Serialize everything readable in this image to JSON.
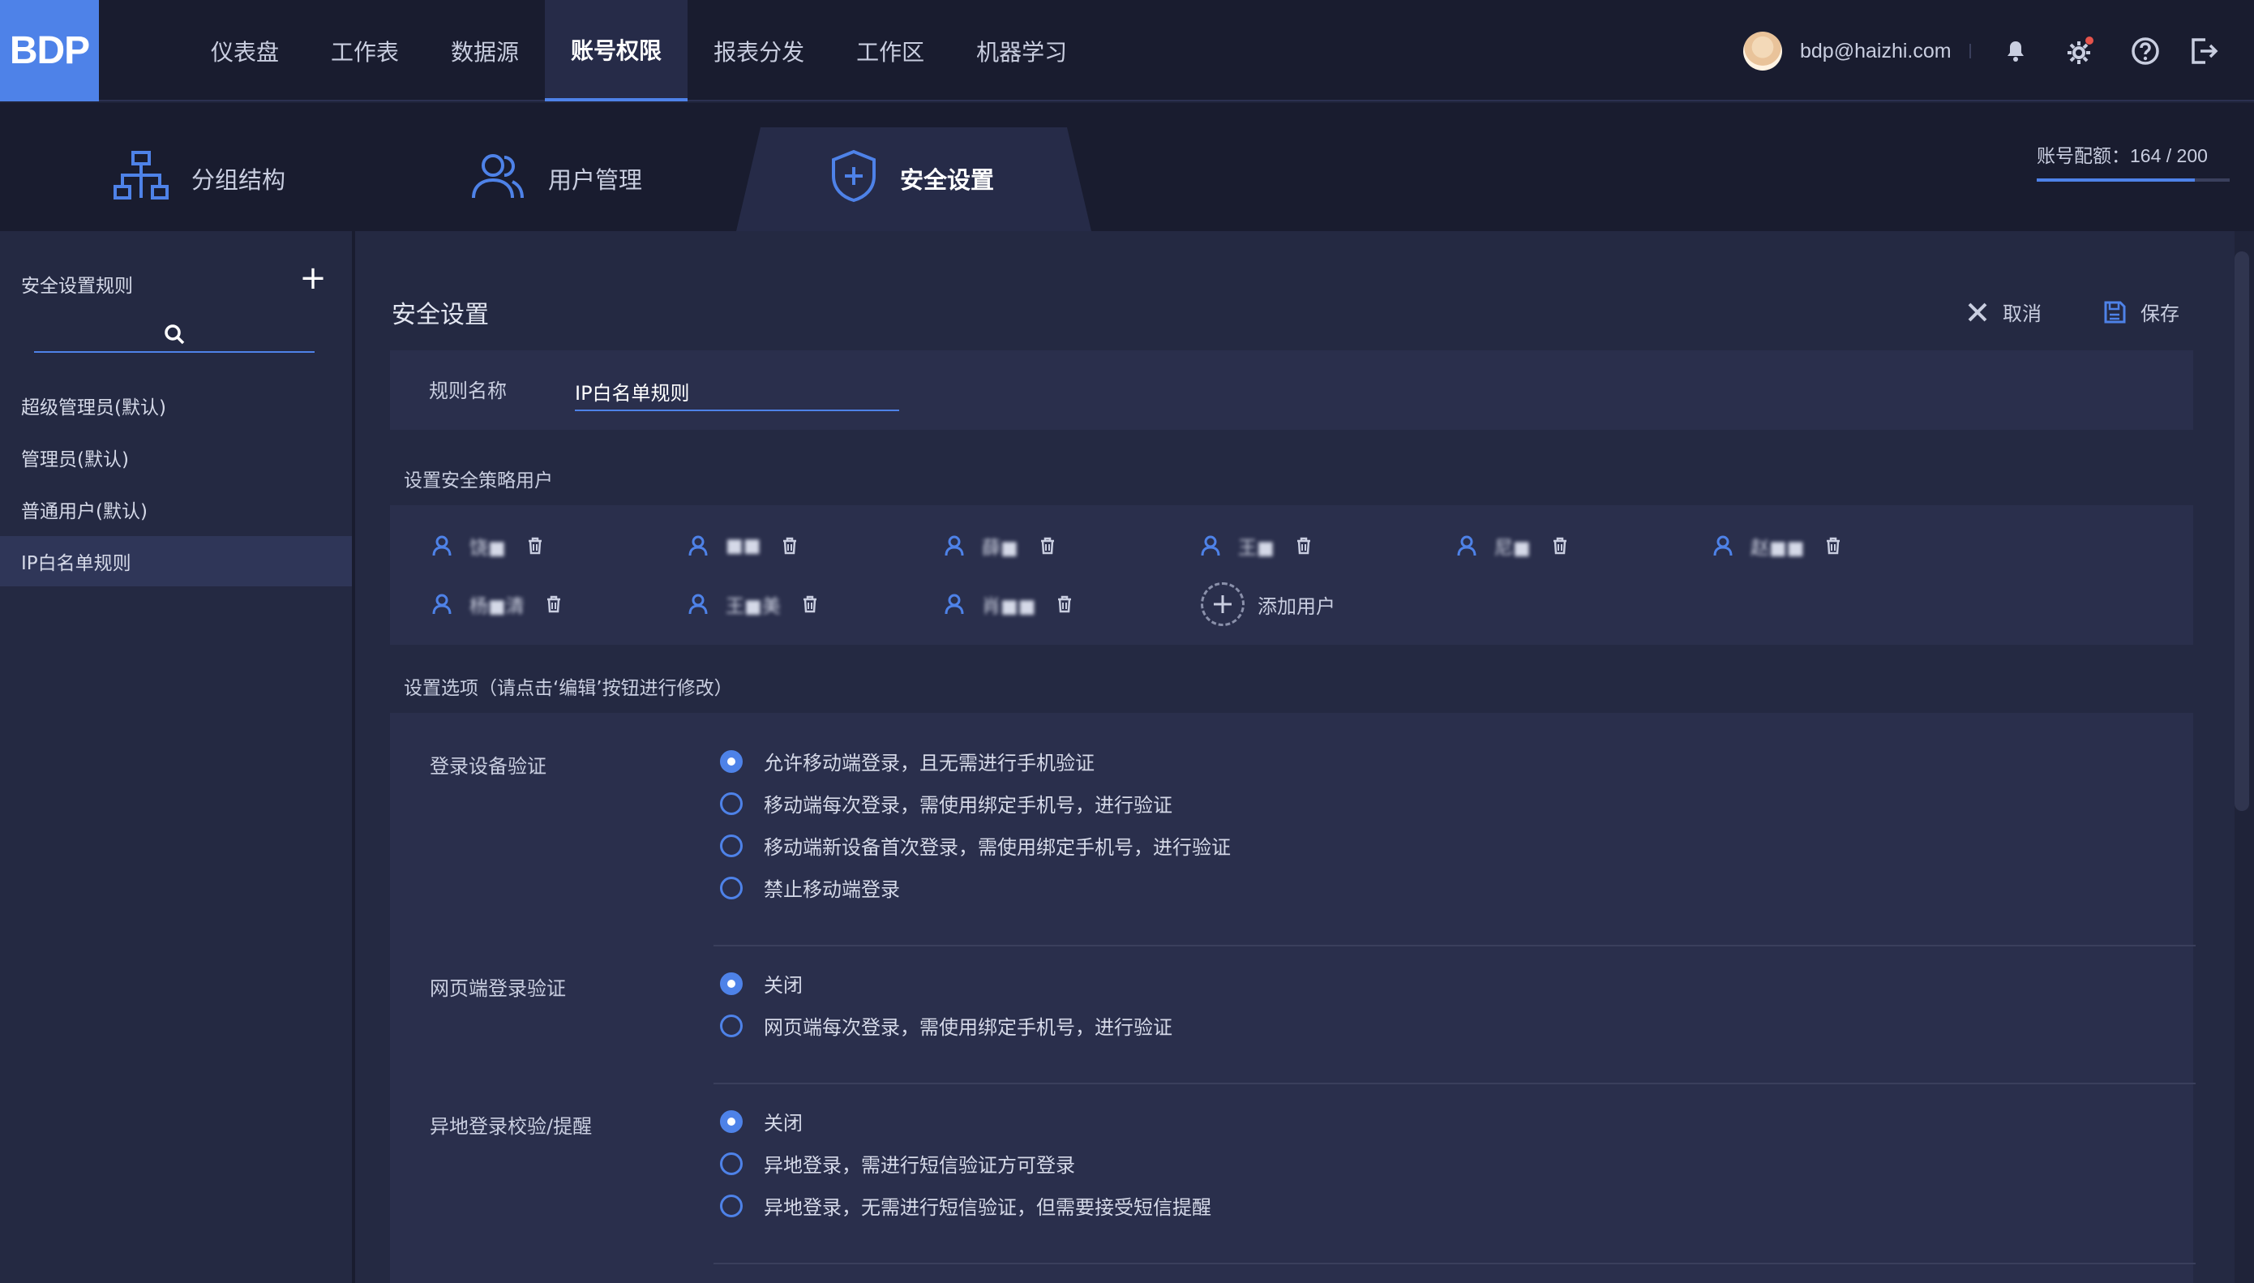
{
  "app": {
    "logo": "BDP"
  },
  "nav": {
    "items": [
      {
        "label": "仪表盘"
      },
      {
        "label": "工作表"
      },
      {
        "label": "数据源"
      },
      {
        "label": "账号权限"
      },
      {
        "label": "报表分发"
      },
      {
        "label": "工作区"
      },
      {
        "label": "机器学习"
      }
    ],
    "active_index": 3
  },
  "user": {
    "email": "bdp@haizhi.com"
  },
  "subtabs": [
    {
      "label": "分组结构",
      "icon": "org-chart-icon"
    },
    {
      "label": "用户管理",
      "icon": "users-icon"
    },
    {
      "label": "安全设置",
      "icon": "shield-plus-icon"
    }
  ],
  "quota": {
    "label": "账号配额：",
    "used": "164",
    "sep": " / ",
    "total": "200",
    "fraction": 0.82
  },
  "sidebar": {
    "title": "安全设置规则",
    "search_placeholder": "",
    "items": [
      {
        "label": "超级管理员(默认)"
      },
      {
        "label": "管理员(默认)"
      },
      {
        "label": "普通用户(默认)"
      },
      {
        "label": "IP白名单规则"
      }
    ],
    "active_index": 3
  },
  "main": {
    "title": "安全设置",
    "cancel": "取消",
    "save": "保存",
    "rule_name_label": "规则名称",
    "rule_name_value": "IP白名单规则",
    "users_section": "设置安全策略用户",
    "users": [
      "饶■",
      "■■",
      "薛■",
      "王■",
      "尼■",
      "赵■■",
      "杨■清",
      "王■美",
      "肖■■"
    ],
    "add_user": "添加用户",
    "options_section": "设置选项（请点击‘编辑’按钮进行修改）",
    "groups": [
      {
        "label": "登录设备验证",
        "options": [
          "允许移动端登录，且无需进行手机验证",
          "移动端每次登录，需使用绑定手机号，进行验证",
          "移动端新设备首次登录，需使用绑定手机号，进行验证",
          "禁止移动端登录"
        ],
        "selected": 0
      },
      {
        "label": "网页端登录验证",
        "options": [
          "关闭",
          "网页端每次登录，需使用绑定手机号，进行验证"
        ],
        "selected": 0
      },
      {
        "label": "异地登录校验/提醒",
        "options": [
          "关闭",
          "异地登录，需进行短信验证方可登录",
          "异地登录，无需进行短信验证，但需要接受短信提醒"
        ],
        "selected": 0
      }
    ]
  },
  "colors": {
    "accent": "#4e82e8",
    "bg": "#1f2339",
    "panel": "#2a2f4c",
    "notify": "#e5534b"
  }
}
